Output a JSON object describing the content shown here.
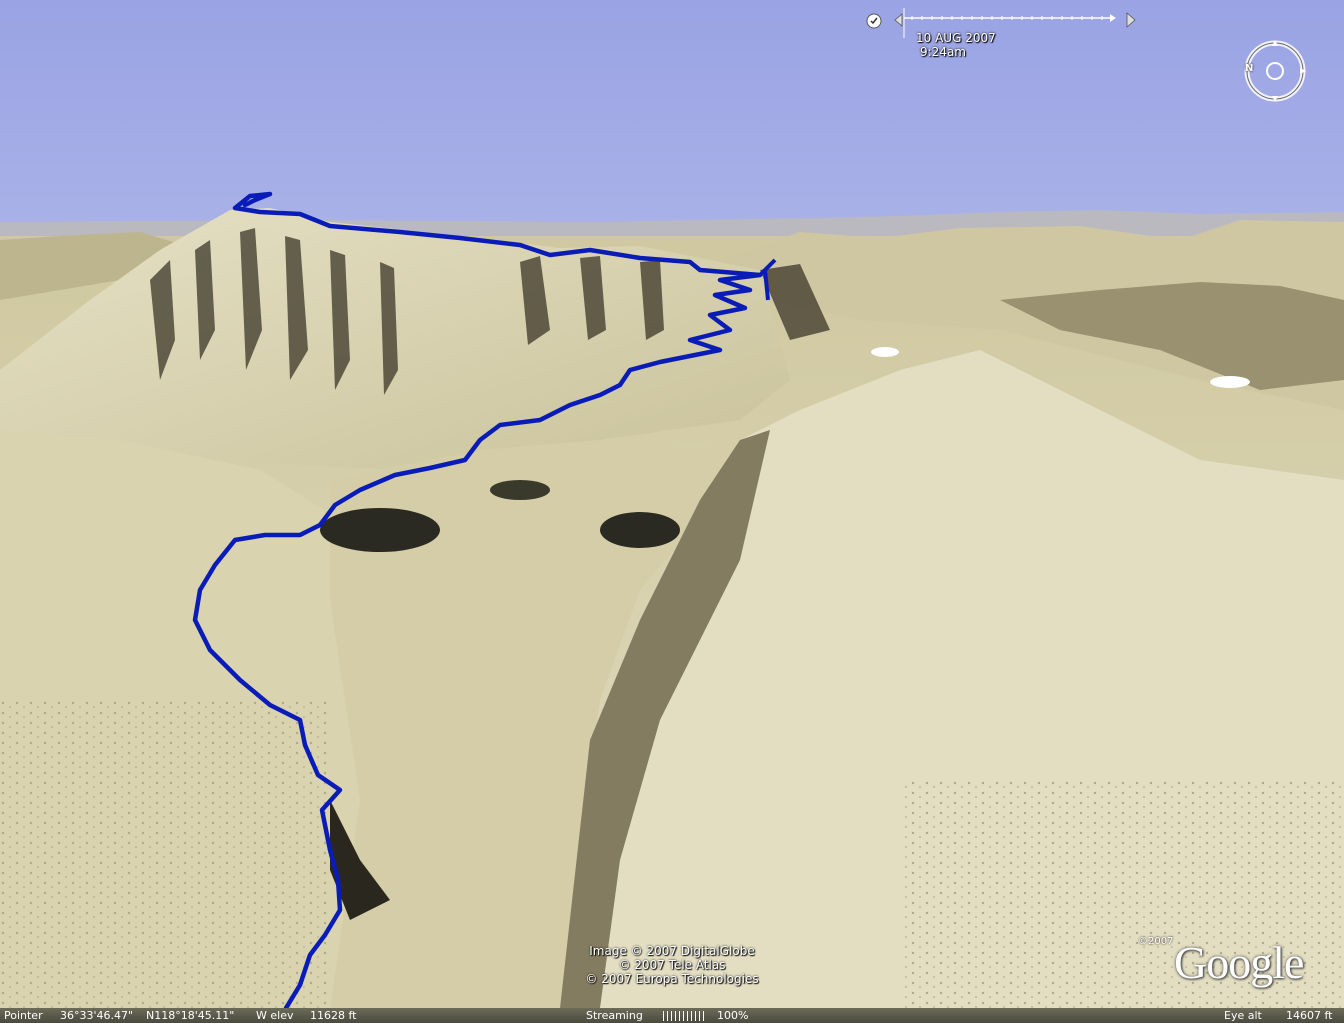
{
  "time_slider": {
    "date": "10 AUG 2007",
    "time": "9:24am"
  },
  "compass": {
    "north_label": "N"
  },
  "attribution": [
    "Image © 2007 DigitalGlobe",
    "© 2007 Tele Atlas",
    "© 2007 Europa Technologies"
  ],
  "logo": {
    "copyright": "©2007",
    "wordmark": "Google"
  },
  "status_bar": {
    "pointer_label": "Pointer",
    "latitude": "36°33'46.47\"",
    "longitude": "N118°18'45.11\"",
    "elev_label": "W elev",
    "elevation": "11628 ft",
    "streaming_label": "Streaming",
    "streaming_percent": "100%",
    "eye_alt_label": "Eye alt",
    "eye_alt": "14607 ft"
  },
  "colors": {
    "sky": "#9ea8e6",
    "terrain": "#d8d2ab",
    "trail": "#0a1cb8"
  },
  "icons": [
    "clock-icon",
    "slider-left-arrow-icon",
    "slider-right-arrow-icon",
    "compass-icon"
  ]
}
